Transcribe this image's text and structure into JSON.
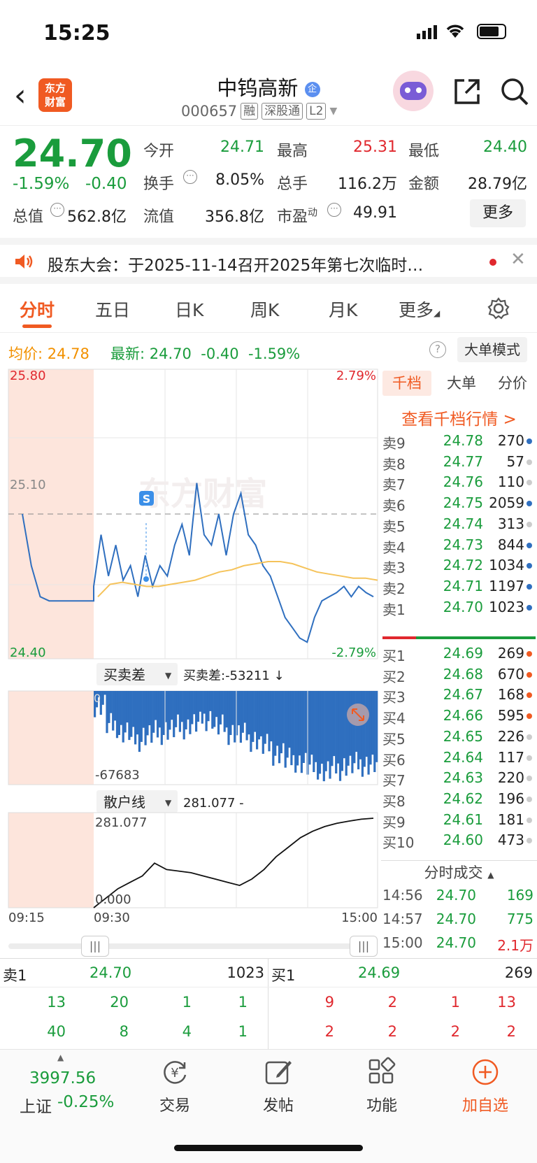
{
  "status_bar": {
    "time": "15:25"
  },
  "header": {
    "logo_text": "东方财富",
    "stock_name": "中钨高新",
    "name_badge": "企",
    "stock_code": "000657",
    "tags": [
      "融",
      "深股通",
      "L2"
    ]
  },
  "quote": {
    "price": "24.70",
    "change_pct": "-1.59%",
    "change": "-0.40",
    "open_label": "今开",
    "open": "24.71",
    "high_label": "最高",
    "high": "25.31",
    "low_label": "最低",
    "low": "24.40",
    "turnover_label": "换手",
    "turnover": "8.05%",
    "volume_label": "总手",
    "volume": "116.2万",
    "amount_label": "金额",
    "amount": "28.79亿",
    "mktcap_label": "总值",
    "mktcap": "562.8亿",
    "float_label": "流值",
    "float": "356.8亿",
    "pe_label": "市盈",
    "pe_sup": "动",
    "pe": "49.91",
    "more_button": "更多"
  },
  "notice": {
    "text": "股东大会：于2025-11-14召开2025年第七次临时…"
  },
  "tabs": [
    {
      "label": "分时",
      "active": true
    },
    {
      "label": "五日"
    },
    {
      "label": "日K"
    },
    {
      "label": "周K"
    },
    {
      "label": "月K"
    },
    {
      "label": "更多"
    }
  ],
  "info_line": {
    "avg_label": "均价:",
    "avg": "24.78",
    "last_label": "最新:",
    "last": "24.70",
    "change": "-0.40",
    "change_pct": "-1.59%",
    "mode_button": "大单模式"
  },
  "chart_data": {
    "type": "line",
    "y_high_label": "25.80",
    "y_mid_label": "25.10",
    "y_low_label": "24.40",
    "pct_high_label": "2.79%",
    "pct_low_label": "-2.79%",
    "ylim": [
      24.4,
      25.8
    ],
    "prev_close": 25.1,
    "x_labels": [
      "09:15",
      "09:30",
      "15:00"
    ],
    "watermark": "东方财富",
    "marker": "S",
    "series": [
      {
        "name": "price",
        "values": [
          25.1,
          24.85,
          24.7,
          24.68,
          24.68,
          24.68,
          24.68,
          24.68,
          24.68,
          24.75,
          25.0,
          24.8,
          24.95,
          24.78,
          24.85,
          24.7,
          24.9,
          24.75,
          24.85,
          24.8,
          24.95,
          25.05,
          24.9,
          25.25,
          25.0,
          24.95,
          25.1,
          24.9,
          25.1,
          25.2,
          25.0,
          24.95,
          24.85,
          24.8,
          24.7,
          24.6,
          24.55,
          24.5,
          24.48,
          24.6,
          24.68,
          24.7,
          24.72,
          24.75,
          24.7,
          24.75,
          24.72,
          24.7
        ]
      },
      {
        "name": "avg",
        "values": [
          24.7,
          24.76,
          24.77,
          24.76,
          24.75,
          24.75,
          24.76,
          24.77,
          24.78,
          24.8,
          24.82,
          24.83,
          24.85,
          24.86,
          24.87,
          24.87,
          24.86,
          24.84,
          24.82,
          24.81,
          24.8,
          24.79,
          24.79,
          24.78
        ]
      }
    ],
    "sub1": {
      "selector": "买卖差",
      "label": "买卖差:-53211 ↓",
      "min_label": "-67683",
      "top_label": "0",
      "values": [
        -10000,
        -25000,
        -30000,
        -35000,
        -32000,
        -30000,
        -28000,
        -26000,
        -24000,
        -20000,
        -26000,
        -30000,
        -32000,
        -35000,
        -40000,
        -45000,
        -50000,
        -52000,
        -55000,
        -58000,
        -56000,
        -54000,
        -53000,
        -53211
      ]
    },
    "sub2": {
      "selector": "散户线",
      "label": "281.077 -",
      "max_label": "281.077",
      "min_label": "0.000",
      "values": [
        0,
        30,
        60,
        80,
        100,
        140,
        120,
        115,
        110,
        100,
        90,
        80,
        70,
        90,
        120,
        160,
        190,
        220,
        240,
        255,
        265,
        272,
        278,
        281.077
      ]
    }
  },
  "order_book": {
    "tabs": [
      "千档",
      "大单",
      "分价"
    ],
    "link": "查看千档行情 >",
    "asks": [
      {
        "label": "卖9",
        "price": "24.78",
        "vol": "270",
        "dot": "#2f6fbf"
      },
      {
        "label": "卖8",
        "price": "24.77",
        "vol": "57",
        "dot": "#ccc"
      },
      {
        "label": "卖7",
        "price": "24.76",
        "vol": "110",
        "dot": "#ccc"
      },
      {
        "label": "卖6",
        "price": "24.75",
        "vol": "2059",
        "dot": "#2f6fbf"
      },
      {
        "label": "卖5",
        "price": "24.74",
        "vol": "313",
        "dot": "#ccc"
      },
      {
        "label": "卖4",
        "price": "24.73",
        "vol": "844",
        "dot": "#2f6fbf"
      },
      {
        "label": "卖3",
        "price": "24.72",
        "vol": "1034",
        "dot": "#2f6fbf"
      },
      {
        "label": "卖2",
        "price": "24.71",
        "vol": "1197",
        "dot": "#2f6fbf"
      },
      {
        "label": "卖1",
        "price": "24.70",
        "vol": "1023",
        "dot": "#2f6fbf"
      }
    ],
    "bids": [
      {
        "label": "买1",
        "price": "24.69",
        "vol": "269",
        "dot": "#f05a22"
      },
      {
        "label": "买2",
        "price": "24.68",
        "vol": "670",
        "dot": "#f05a22"
      },
      {
        "label": "买3",
        "price": "24.67",
        "vol": "168",
        "dot": "#f05a22"
      },
      {
        "label": "买4",
        "price": "24.66",
        "vol": "595",
        "dot": "#f05a22"
      },
      {
        "label": "买5",
        "price": "24.65",
        "vol": "226",
        "dot": "#ccc"
      },
      {
        "label": "买6",
        "price": "24.64",
        "vol": "117",
        "dot": "#ccc"
      },
      {
        "label": "买7",
        "price": "24.63",
        "vol": "220",
        "dot": "#ccc"
      },
      {
        "label": "买8",
        "price": "24.62",
        "vol": "196",
        "dot": "#ccc"
      },
      {
        "label": "买9",
        "price": "24.61",
        "vol": "181",
        "dot": "#ccc"
      },
      {
        "label": "买10",
        "price": "24.60",
        "vol": "473",
        "dot": "#ccc"
      }
    ],
    "trades_title": "分时成交",
    "trades": [
      {
        "time": "14:56",
        "price": "24.70",
        "vol": "169",
        "color": "#1a9c3c"
      },
      {
        "time": "14:57",
        "price": "24.70",
        "vol": "775",
        "color": "#1a9c3c"
      },
      {
        "time": "15:00",
        "price": "24.70",
        "vol": "2.1万",
        "color": "#e0282e"
      }
    ]
  },
  "queue": {
    "sell_label": "卖1",
    "sell_price": "24.70",
    "sell_vol": "1023",
    "buy_label": "买1",
    "buy_price": "24.69",
    "buy_vol": "269",
    "sell_row1": [
      "13",
      "20",
      "1",
      "1"
    ],
    "sell_row2": [
      "40",
      "8",
      "4",
      "1"
    ],
    "buy_row1": [
      "9",
      "2",
      "1",
      "13"
    ],
    "buy_row2": [
      "2",
      "2",
      "2",
      "2"
    ]
  },
  "bottom_nav": {
    "index_value": "3997.56",
    "index_name": "上证",
    "index_change": "-0.25%",
    "items": [
      "交易",
      "发帖",
      "功能",
      "加自选"
    ]
  }
}
